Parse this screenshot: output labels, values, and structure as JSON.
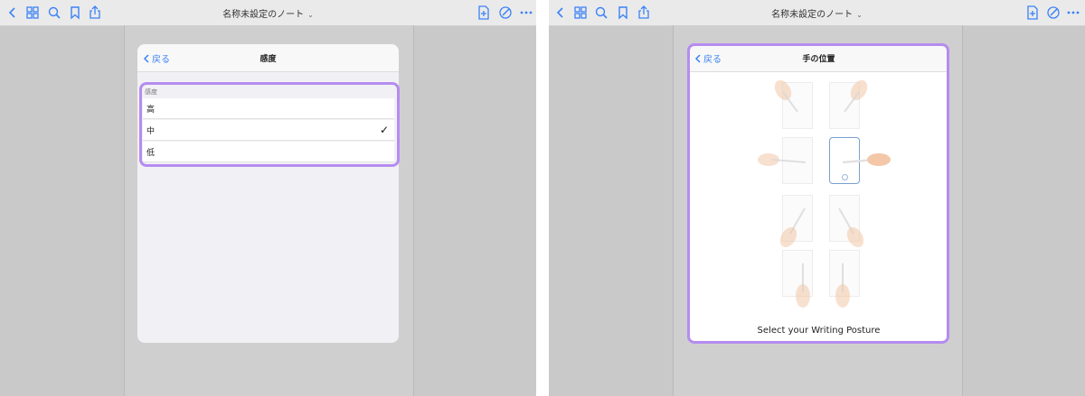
{
  "left": {
    "toolbar": {
      "title": "名称未設定のノート",
      "icons": [
        "chevron-left-icon",
        "grid-icon",
        "search-icon",
        "bookmark-icon",
        "share-icon",
        "add-page-icon",
        "pen-settings-icon",
        "more-icon"
      ]
    },
    "modal": {
      "back_label": "戻る",
      "title": "感度",
      "section_label": "感度",
      "options": [
        {
          "label": "高",
          "checked": false
        },
        {
          "label": "中",
          "checked": true
        },
        {
          "label": "低",
          "checked": false
        }
      ],
      "check_glyph": "✓"
    }
  },
  "right": {
    "toolbar": {
      "title": "名称未設定のノート"
    },
    "modal": {
      "back_label": "戻る",
      "title": "手の位置",
      "caption": "Select your Writing Posture",
      "selected_posture": "right-horizontal"
    }
  },
  "colors": {
    "accent": "#3b82f6",
    "highlight": "#b58cf0",
    "skin": "#f3c7a8",
    "tile_selected_border": "#7a9fcf"
  }
}
